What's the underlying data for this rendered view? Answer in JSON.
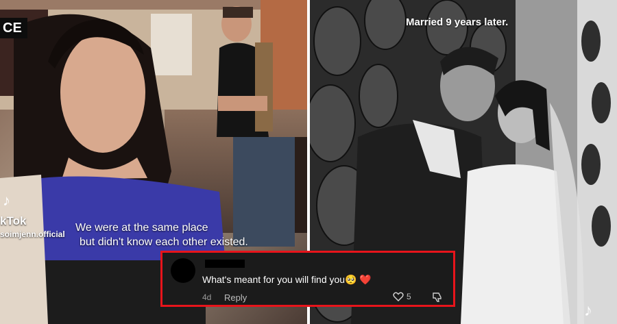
{
  "left_panel": {
    "store_sign": "CE",
    "watermark_brand": "kTok",
    "watermark_handle": "soimjenn.official",
    "caption_line1": "We were at the same place",
    "caption_line2": "but didn't know each other existed."
  },
  "right_panel": {
    "caption": "Married 9 years later."
  },
  "comment": {
    "text": "What's meant for you will find you🥺 ❤️",
    "age": "4d",
    "reply_label": "Reply",
    "like_count": "5"
  },
  "colors": {
    "highlight_border": "#e8141b",
    "comment_bg": "#1b1b1b"
  }
}
